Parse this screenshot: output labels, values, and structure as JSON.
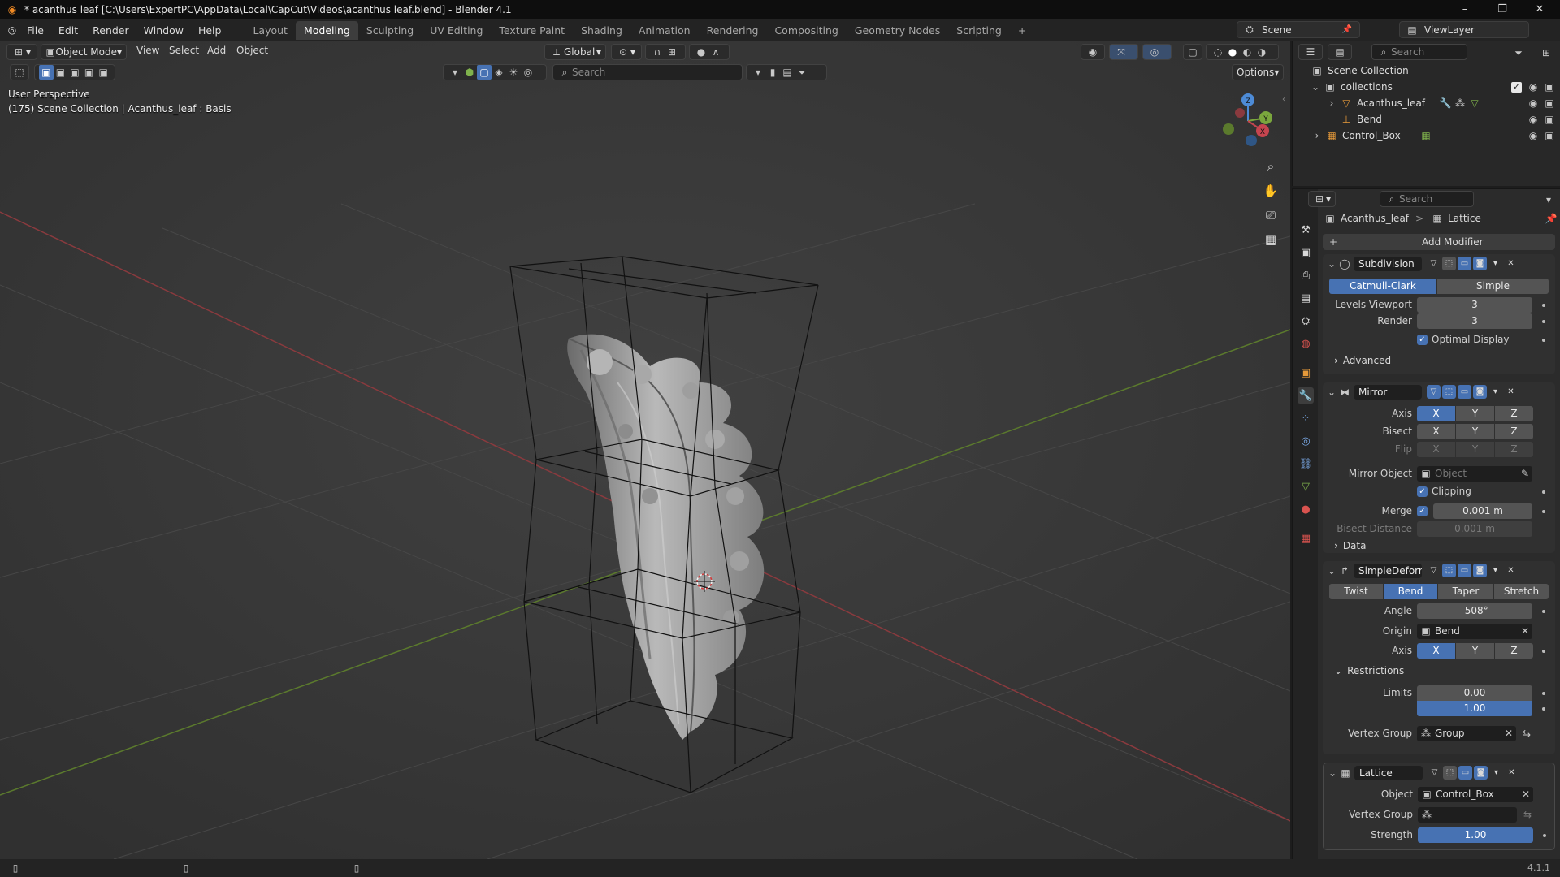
{
  "titlebar": {
    "title": "* acanthus leaf [C:\\Users\\ExpertPC\\AppData\\Local\\CapCut\\Videos\\acanthus leaf.blend] - Blender 4.1"
  },
  "menu": {
    "items": [
      "File",
      "Edit",
      "Render",
      "Window",
      "Help"
    ]
  },
  "workspaces": {
    "tabs": [
      "Layout",
      "Modeling",
      "Sculpting",
      "UV Editing",
      "Texture Paint",
      "Shading",
      "Animation",
      "Rendering",
      "Compositing",
      "Geometry Nodes",
      "Scripting"
    ],
    "active": "Modeling",
    "add_label": "+"
  },
  "scene_selector": {
    "value": "Scene"
  },
  "viewlayer_selector": {
    "value": "ViewLayer"
  },
  "viewport_header": {
    "mode": "Object Mode",
    "menus": [
      "View",
      "Select",
      "Add",
      "Object"
    ],
    "orientation": "Global",
    "search_placeholder": "Search",
    "options_label": "Options"
  },
  "viewport_overlay": {
    "perspective": "User Perspective",
    "context": "(175) Scene Collection | Acanthus_leaf : Basis"
  },
  "gizmo": {
    "x": "X",
    "y": "Y",
    "z": "Z"
  },
  "outliner": {
    "search_placeholder": "Search",
    "rows": [
      {
        "label": "Scene Collection"
      },
      {
        "label": "collections"
      },
      {
        "label": "Acanthus_leaf"
      },
      {
        "label": "Bend"
      },
      {
        "label": "Control_Box"
      }
    ]
  },
  "properties": {
    "search_placeholder": "Search",
    "breadcrumb": {
      "object": "Acanthus_leaf",
      "separator": ">",
      "modifier": "Lattice"
    },
    "add_modifier_label": "Add Modifier",
    "subdivision": {
      "name": "Subdivision",
      "type_options": [
        "Catmull-Clark",
        "Simple"
      ],
      "type_selected": "Catmull-Clark",
      "levels_viewport_label": "Levels Viewport",
      "levels_viewport": "3",
      "render_label": "Render",
      "render": "3",
      "optimal_display_label": "Optimal Display",
      "optimal_display": true,
      "advanced_label": "Advanced"
    },
    "mirror": {
      "name": "Mirror",
      "axis_label": "Axis",
      "bisect_label": "Bisect",
      "flip_label": "Flip",
      "axes": [
        "X",
        "Y",
        "Z"
      ],
      "axis_selected": "X",
      "mirror_object_label": "Mirror Object",
      "mirror_object_placeholder": "Object",
      "clipping_label": "Clipping",
      "clipping": true,
      "merge_label": "Merge",
      "merge": "0.001 m",
      "bisect_distance_label": "Bisect Distance",
      "bisect_distance": "0.001 m",
      "data_label": "Data"
    },
    "simpledeform": {
      "name": "SimpleDeform",
      "modes": [
        "Twist",
        "Bend",
        "Taper",
        "Stretch"
      ],
      "mode_selected": "Bend",
      "angle_label": "Angle",
      "angle": "-508°",
      "origin_label": "Origin",
      "origin": "Bend",
      "axis_label": "Axis",
      "axes": [
        "X",
        "Y",
        "Z"
      ],
      "axis_selected": "X",
      "restrictions_label": "Restrictions",
      "limits_label": "Limits",
      "limit_min": "0.00",
      "limit_max": "1.00",
      "vertex_group_label": "Vertex Group",
      "vertex_group": "Group"
    },
    "lattice": {
      "name": "Lattice",
      "object_label": "Object",
      "object": "Control_Box",
      "vertex_group_label": "Vertex Group",
      "vertex_group": "",
      "strength_label": "Strength",
      "strength": "1.00"
    }
  },
  "statusbar": {
    "version": "4.1.1"
  },
  "colors": {
    "accent": "#4772b3",
    "axis_x": "#c6454f",
    "axis_y": "#7aa63d",
    "axis_z": "#4d8bd6"
  }
}
